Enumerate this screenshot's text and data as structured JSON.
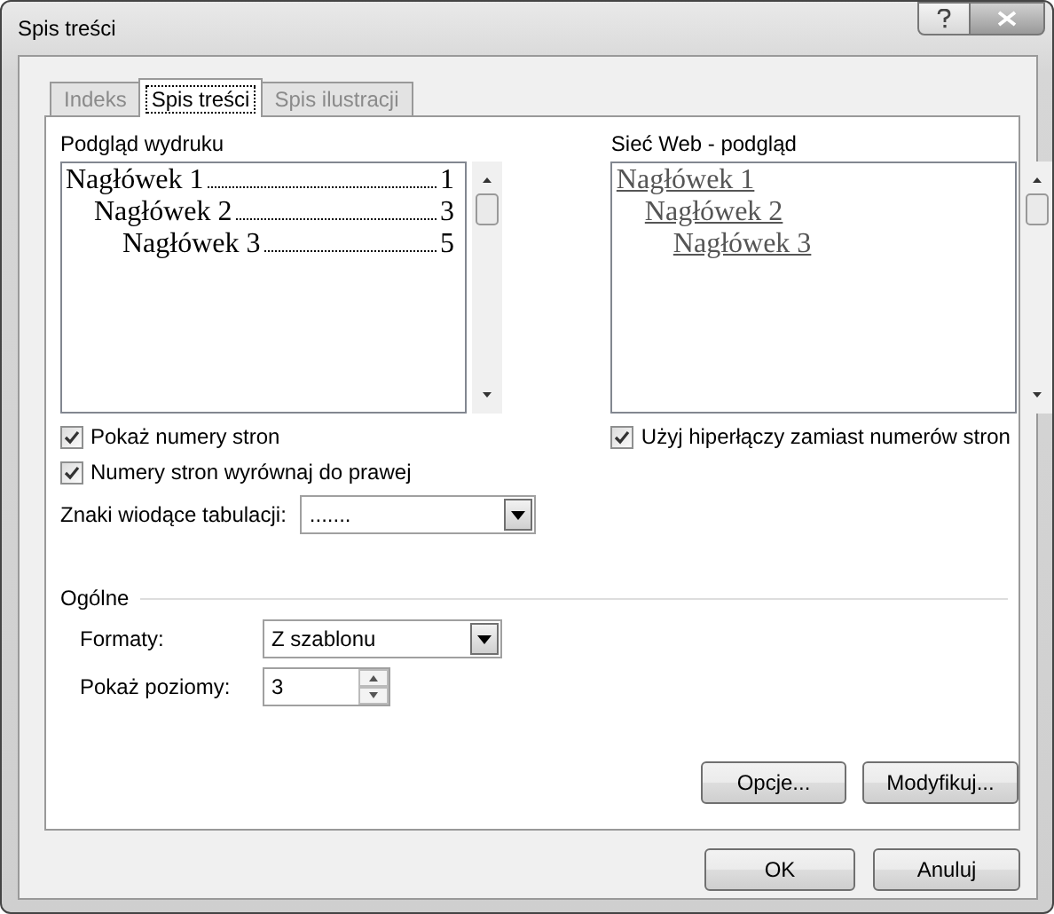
{
  "window": {
    "title": "Spis treści"
  },
  "tabs": [
    {
      "label": "Indeks",
      "selected": false
    },
    {
      "label": "Spis treści",
      "selected": true
    },
    {
      "label": "Spis ilustracji",
      "selected": false
    }
  ],
  "print_preview": {
    "label": "Podgląd wydruku",
    "entries": [
      {
        "text": "Nagłówek 1",
        "page": "1",
        "children": [
          {
            "text": "Nagłówek 2",
            "page": "3",
            "children": [
              {
                "text": "Nagłówek 3",
                "page": "5"
              }
            ]
          }
        ]
      }
    ]
  },
  "web_preview": {
    "label": "Sieć Web - podgląd",
    "entries": [
      {
        "text": "Nagłówek 1",
        "children": [
          {
            "text": "Nagłówek 2",
            "children": [
              {
                "text": "Nagłówek 3"
              }
            ]
          }
        ]
      }
    ]
  },
  "print_options": {
    "checkboxes": [
      {
        "label": "Pokaż numery stron",
        "checked": true
      },
      {
        "label": "Numery stron wyrównaj do prawej",
        "checked": true
      }
    ],
    "tab_leader": {
      "label": "Znaki wiodące tabulacji:",
      "value": "......."
    }
  },
  "web_options": {
    "checkboxes": [
      {
        "label": "Użyj hiperłączy zamiast numerów stron",
        "checked": true
      }
    ]
  },
  "general": {
    "title": "Ogólne",
    "formats": {
      "label": "Formaty:",
      "value": "Z szablonu"
    },
    "levels": {
      "label": "Pokaż poziomy:",
      "value": "3"
    }
  },
  "panel_buttons": [
    "Opcje...",
    "Modyfikuj..."
  ],
  "dialog_buttons": [
    "OK",
    "Anuluj"
  ]
}
